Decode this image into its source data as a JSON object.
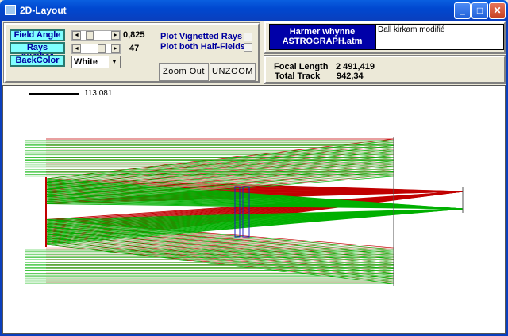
{
  "window": {
    "title": "2D-Layout",
    "minimize": "_",
    "maximize": "□",
    "close": "✕"
  },
  "controls": {
    "field_angle": {
      "label": "Field Angle",
      "value": "0,825",
      "fraction": 0.2
    },
    "rays_number": {
      "label": "Rays number",
      "value": "47",
      "fraction": 0.75
    },
    "back_color": {
      "label": "BackColor",
      "selected": "White"
    },
    "plot_vignetted": {
      "label": "Plot Vignetted Rays",
      "checked": false
    },
    "plot_both": {
      "label": "Plot both Half-Fields",
      "checked": false
    },
    "zoom_out": "Zoom Out",
    "unzoom": "UNZOOM"
  },
  "info": {
    "system_name_line1": "Harmer whynne",
    "system_name_line2": "ASTROGRAPH.atm",
    "comment": "Dall kirkam modifié",
    "focal_length_label": "Focal Length",
    "focal_length": "2 491,419",
    "total_track_label": "Total Track",
    "total_track": "942,34"
  },
  "plot": {
    "scale_value": "113,081",
    "colors": {
      "field1": "#c00000",
      "field1_light": "#f08080",
      "field2": "#00b000",
      "field2_light": "#60d060",
      "lens": "#2020c0"
    }
  }
}
